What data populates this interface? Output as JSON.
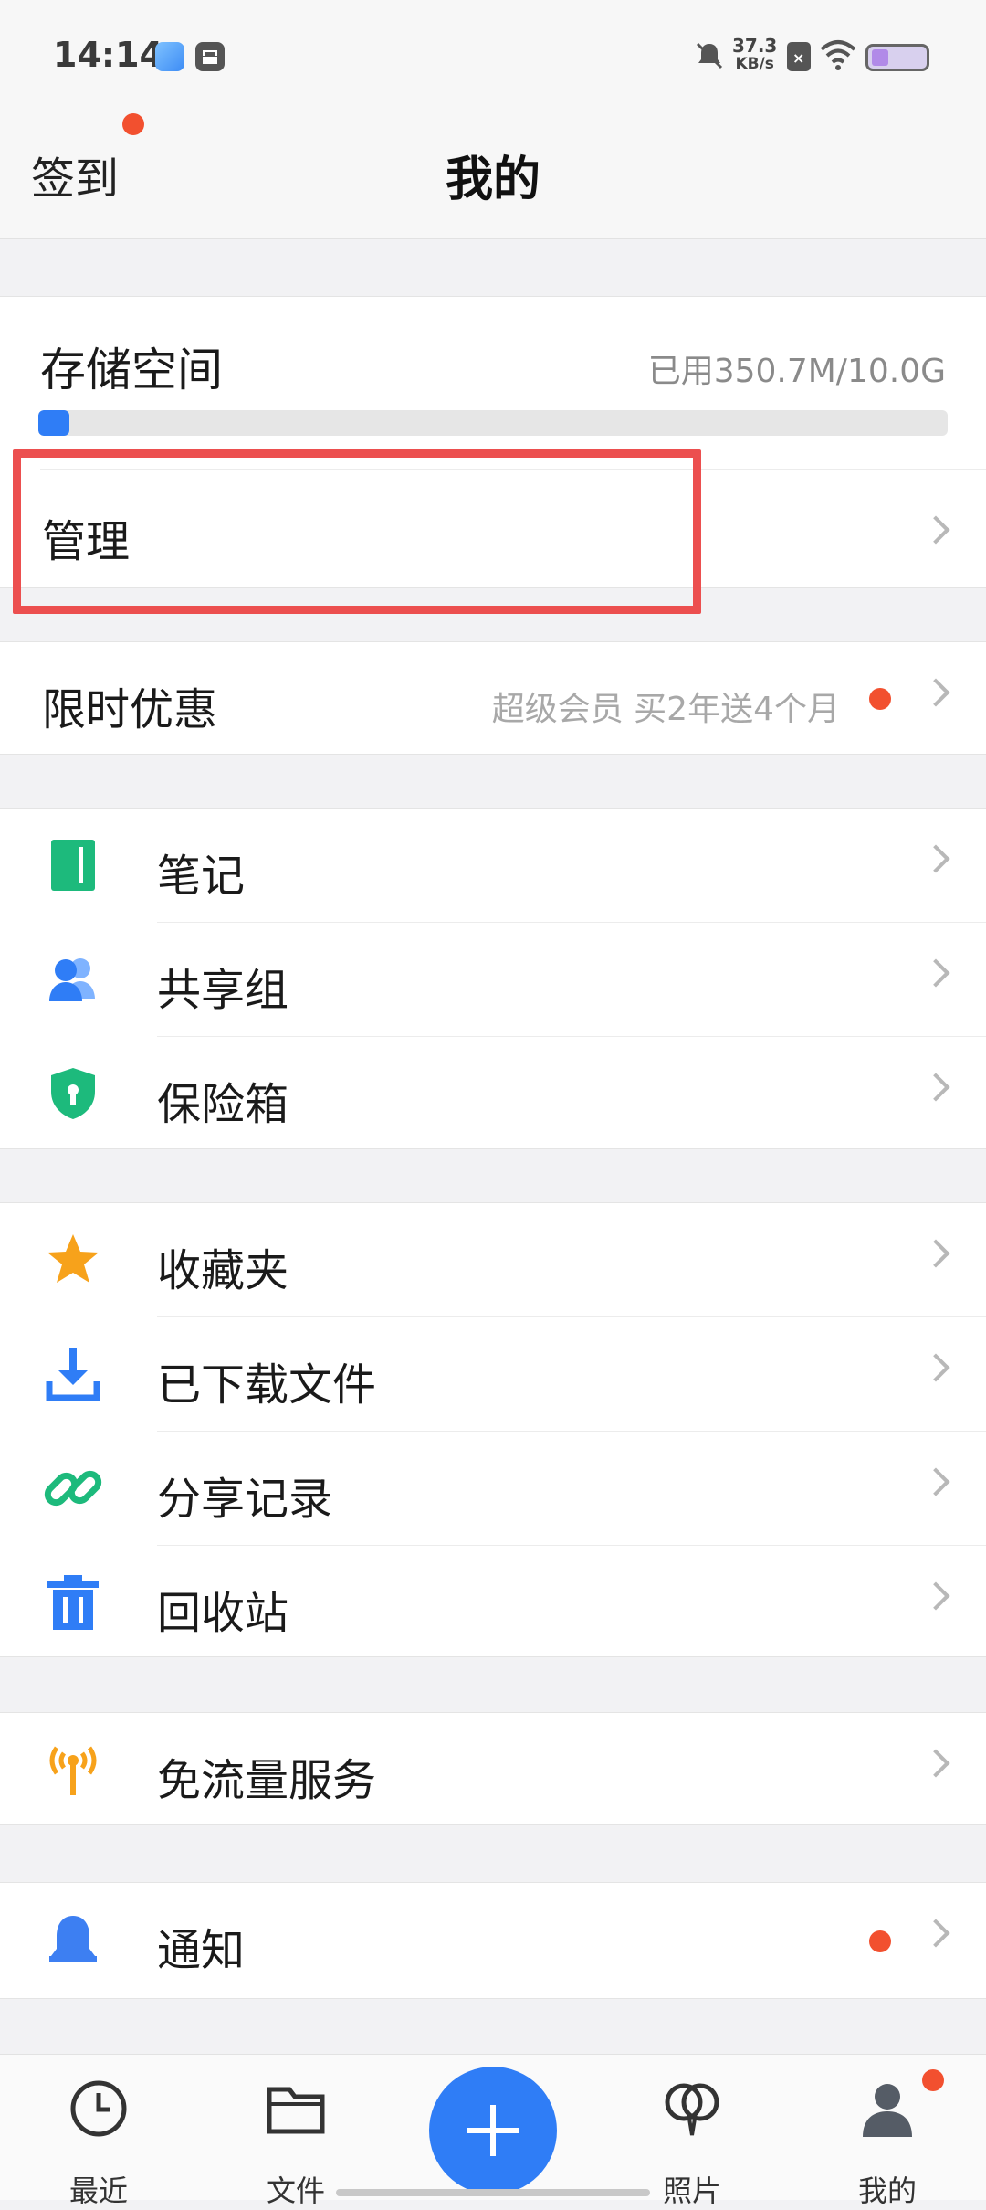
{
  "status_bar": {
    "time": "14:14",
    "net_speed_value": "37.3",
    "net_speed_unit": "KB/s"
  },
  "header": {
    "checkin_label": "签到",
    "title": "我的"
  },
  "storage": {
    "title": "存储空间",
    "used_text": "已用350.7M/10.0G",
    "used_fraction": 0.034,
    "manage_label": "管理"
  },
  "promo": {
    "label": "限时优惠",
    "detail": "超级会员 买2年送4个月"
  },
  "group1": [
    {
      "label": "笔记",
      "icon": "notebook-icon"
    },
    {
      "label": "共享组",
      "icon": "group-icon"
    },
    {
      "label": "保险箱",
      "icon": "safe-shield-icon"
    }
  ],
  "group2": [
    {
      "label": "收藏夹",
      "icon": "star-icon"
    },
    {
      "label": "已下载文件",
      "icon": "download-icon"
    },
    {
      "label": "分享记录",
      "icon": "link-icon"
    },
    {
      "label": "回收站",
      "icon": "trash-icon"
    }
  ],
  "group3": [
    {
      "label": "免流量服务",
      "icon": "antenna-icon"
    }
  ],
  "group4": [
    {
      "label": "通知",
      "icon": "bell-icon"
    }
  ],
  "bottom_nav": [
    {
      "label": "最近",
      "icon": "clock-icon"
    },
    {
      "label": "文件",
      "icon": "folder-icon"
    },
    {
      "label": "",
      "icon": "plus-icon"
    },
    {
      "label": "照片",
      "icon": "photos-icon"
    },
    {
      "label": "我的",
      "icon": "person-icon"
    }
  ],
  "colors": {
    "accent": "#2f7df6",
    "badge": "#f2502f",
    "annotation": "#ec4f4f"
  }
}
